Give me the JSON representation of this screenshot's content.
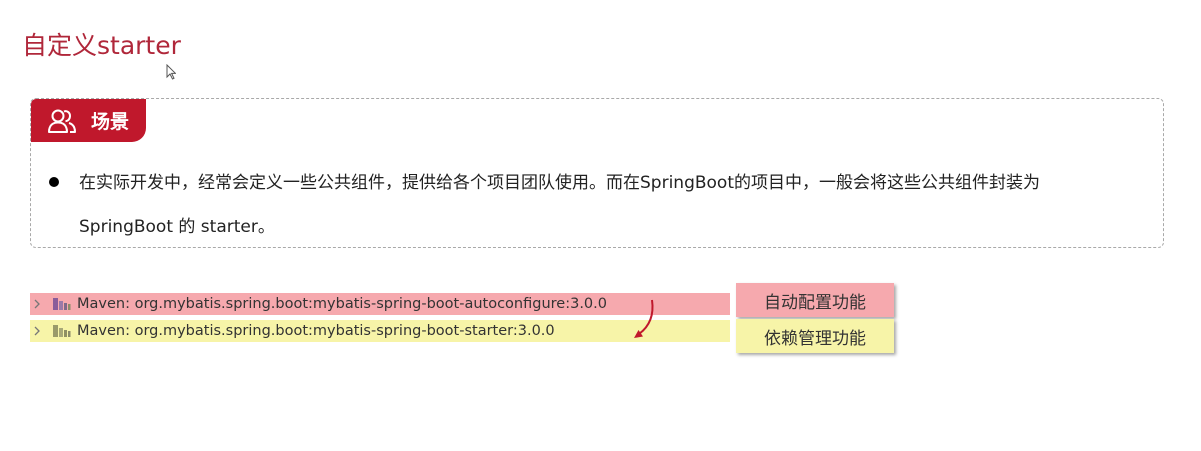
{
  "page": {
    "title": "自定义starter"
  },
  "scene": {
    "tab_label": "场景",
    "bullet_line_1": "在实际开发中，经常会定义一些公共组件，提供给各个项目团队使用。而在SpringBoot的项目中，一般会将这些公共组件封装为",
    "bullet_line_2": "SpringBoot 的 starter。"
  },
  "dependencies": [
    {
      "label": "Maven: org.mybatis.spring.boot:mybatis-spring-boot-autoconfigure:3.0.0",
      "highlight_color": "#f6a9ae"
    },
    {
      "label": "Maven: org.mybatis.spring.boot:mybatis-spring-boot-starter:3.0.0",
      "highlight_color": "#f7f4a8"
    }
  ],
  "callouts": {
    "autoconfigure": "自动配置功能",
    "dependency_management": "依赖管理功能"
  },
  "colors": {
    "title": "#b0273a",
    "tab_background": "#c0182c",
    "arrow": "#c0182c"
  },
  "icons": {
    "tab": "users-icon",
    "tree_toggle": "chevron-right-icon",
    "dependency": "library-icon",
    "relation": "curved-arrow-icon",
    "pointer": "mouse-cursor-icon"
  }
}
